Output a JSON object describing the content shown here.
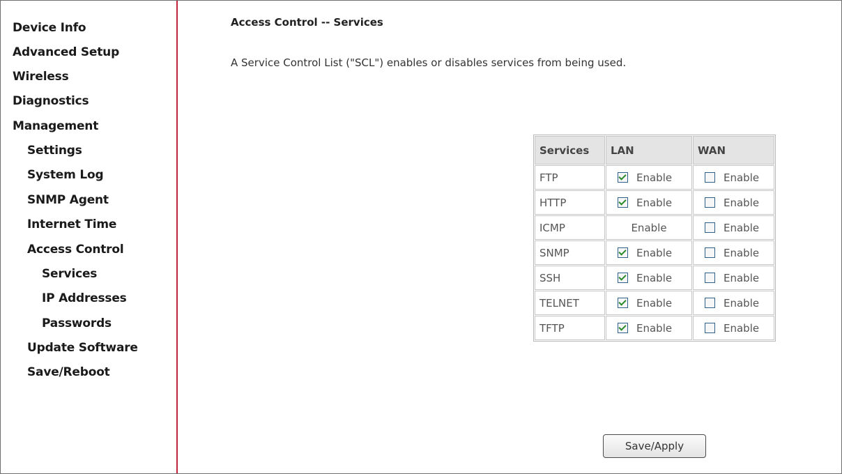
{
  "sidebar": {
    "items": [
      {
        "label": "Device Info"
      },
      {
        "label": "Advanced Setup"
      },
      {
        "label": "Wireless"
      },
      {
        "label": "Diagnostics"
      },
      {
        "label": "Management"
      },
      {
        "label": "Settings"
      },
      {
        "label": "System Log"
      },
      {
        "label": "SNMP Agent"
      },
      {
        "label": "Internet Time"
      },
      {
        "label": "Access Control"
      },
      {
        "label": "Services"
      },
      {
        "label": "IP Addresses"
      },
      {
        "label": "Passwords"
      },
      {
        "label": "Update Software"
      },
      {
        "label": "Save/Reboot"
      }
    ]
  },
  "main": {
    "title": "Access Control -- Services",
    "description": "A Service Control List (\"SCL\") enables or disables services from being used."
  },
  "table": {
    "headers": [
      "Services",
      "LAN",
      "WAN"
    ],
    "rows": [
      {
        "service": "FTP",
        "lan": {
          "has_checkbox": true,
          "checked": true,
          "label": "Enable"
        },
        "wan": {
          "checked": false,
          "label": "Enable"
        }
      },
      {
        "service": "HTTP",
        "lan": {
          "has_checkbox": true,
          "checked": true,
          "label": "Enable"
        },
        "wan": {
          "checked": false,
          "label": "Enable"
        }
      },
      {
        "service": "ICMP",
        "lan": {
          "has_checkbox": false,
          "checked": false,
          "label": "Enable"
        },
        "wan": {
          "checked": false,
          "label": "Enable"
        }
      },
      {
        "service": "SNMP",
        "lan": {
          "has_checkbox": true,
          "checked": true,
          "label": "Enable"
        },
        "wan": {
          "checked": false,
          "label": "Enable"
        }
      },
      {
        "service": "SSH",
        "lan": {
          "has_checkbox": true,
          "checked": true,
          "label": "Enable"
        },
        "wan": {
          "checked": false,
          "label": "Enable"
        }
      },
      {
        "service": "TELNET",
        "lan": {
          "has_checkbox": true,
          "checked": true,
          "label": "Enable"
        },
        "wan": {
          "checked": false,
          "label": "Enable"
        }
      },
      {
        "service": "TFTP",
        "lan": {
          "has_checkbox": true,
          "checked": true,
          "label": "Enable"
        },
        "wan": {
          "checked": false,
          "label": "Enable"
        }
      }
    ]
  },
  "buttons": {
    "save_apply": "Save/Apply"
  },
  "colors": {
    "sidebar_border": "#c0243a",
    "header_bg": "#e4e4e4",
    "check_mark": "#2a8a2a"
  }
}
